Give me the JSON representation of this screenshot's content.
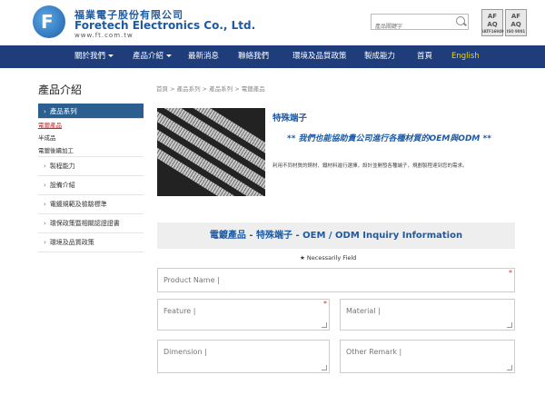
{
  "header": {
    "logo_letter": "F",
    "company_cn": "福業電子股份有限公司",
    "company_en": "Foretech Electronics Co., Ltd.",
    "url": "www.ft.com.tw",
    "search_placeholder": "產品關鍵字",
    "certs": [
      {
        "top": "AF",
        "bottom": "AQ",
        "label": "IATF16949"
      },
      {
        "top": "AF",
        "bottom": "AQ",
        "label": "ISO 9001"
      }
    ]
  },
  "nav": {
    "items": [
      "關於我們",
      "產品介紹",
      "最新消息",
      "聯絡我們",
      "環境及品質政策",
      "製成能力",
      "首頁",
      "English"
    ]
  },
  "sidebar": {
    "title": "產品介紹",
    "active": "產品系列",
    "subs": [
      "電鍍產品",
      "半成品",
      "電鍍後續加工"
    ],
    "items": [
      "製程能力",
      "設備介紹",
      "電鍍規範及檢驗標準",
      "環保政策暨相關認證證書",
      "環境及品質政策"
    ]
  },
  "main": {
    "breadcrumb": "首頁 > 產品系列 > 產品系列 > 電鍍產品",
    "product_title": "特殊端子",
    "slogan": "** 我們也能協助貴公司進行各種材質的OEM與ODM **",
    "desc": "利用不同材質的銅材、鐵材料進行選擇，設計並開發各種端子，規劃製程達到您的需求。",
    "inquiry_title": "電鍍產品 - 特殊端子 - OEM / ODM Inquiry Information",
    "necessary_label": "Necessarily Field",
    "star": "★",
    "required_mark": "*",
    "fields": {
      "product_name": "Product Name |",
      "feature": "Feature |",
      "material": "Material |",
      "dimension": "Dimension |",
      "other_remark": "Other Remark |"
    }
  }
}
